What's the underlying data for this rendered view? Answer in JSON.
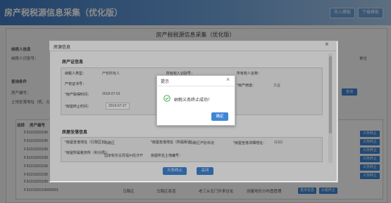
{
  "app": {
    "title": "房产税税源信息采集（优化版）",
    "import_button": "导入模板",
    "download_button": "下载模板"
  },
  "background": {
    "page_title": "房产税税源信息采集（优化版）",
    "taxpayer_section": "纳税人信息",
    "taxpayer_id_label": "纳税人识别号：",
    "unit_label": "单位",
    "condition_section": "查询条件",
    "house_no_label": "房产编号：",
    "address_label": "土地坐落地址（机、分",
    "query_button": "查询",
    "table_header_select": "选择",
    "table_header_house": "房产编号",
    "row_ids": [
      "F3101520190",
      "F3101520190",
      "F3101520190",
      "F3101520190",
      "F3101520190",
      "F3101520190",
      "F3101520190",
      "F3101520190",
      "F3101520190"
    ],
    "row_action_label": "义务终止",
    "bottom_row": {
      "id": "F310152019000001",
      "c1": "马路区",
      "c2": "马路区县道",
      "c3": "老三从北门外来住址",
      "c4": "测量地形分布图管理",
      "btn1": "基本信息",
      "btn2": "从税终止"
    }
  },
  "modal": {
    "title": "房源信息",
    "section1": "房产证信息",
    "fields": {
      "taxpayer_type_label": "纳税人类型：",
      "taxpayer_type_value": "产权所有人",
      "owner_id_label": "所有权人识别号：",
      "owner_name_label": "所有权人名称：",
      "cert_no_label": "产权证书号：",
      "acquire_date_label": "*房产取得时间：",
      "acquire_date_value": "2018-07-01",
      "usage_label": "*房产用途：",
      "usage_value": "工业",
      "terminate_date_label": "*房屋终止时间：",
      "terminate_date_value": "2019-07-27"
    },
    "section2": "房屋坐落信息",
    "location_fields": {
      "region_label": "*房屋坐落地址（行政区划）：",
      "region_value": "马路区",
      "street_label": "*房屋坐落地址（所属街道）：",
      "street_value": "马路区芦卧街道",
      "detail_label": "*房屋坐落详细地址：",
      "detail_value": "11111",
      "tax_authority_label": "*房屋所属税务所（科分局）：",
      "tax_authority_value": "国家税务总局福州经济开",
      "holding_label": "房屋所在土地编号：",
      "holding_value": ""
    },
    "terminate_button": "义务终止",
    "close_button": "关闭"
  },
  "dialog": {
    "title": "提示",
    "message": "纳税义务终止成功！",
    "ok_button": "确定"
  },
  "colors": {
    "brand": "#3f78bf",
    "button": "#3f86d6",
    "success": "#4cae4c"
  }
}
